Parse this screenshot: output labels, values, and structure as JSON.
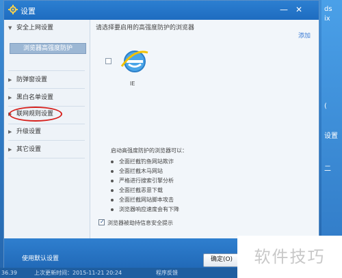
{
  "window": {
    "title": "设置"
  },
  "sidebar": {
    "items": [
      {
        "label": "安全上网设置",
        "expanded": true
      },
      {
        "label": "防弹窗设置",
        "expanded": false
      },
      {
        "label": "黑白名单设置",
        "expanded": false
      },
      {
        "label": "联网规则设置",
        "expanded": false
      },
      {
        "label": "升级设置",
        "expanded": false
      },
      {
        "label": "其它设置",
        "expanded": false
      }
    ],
    "subitem": "浏览器高强度防护"
  },
  "main": {
    "heading": "请选择要启用的高强度防护的浏览器",
    "add_link": "添加",
    "browser_label": "IE",
    "features_title": "启动高强度防护的浏览器可以：",
    "features": [
      "全面拦截钓鱼网站欺诈",
      "全面拦截木马网站",
      "严格进行搜索引擎分析",
      "全面拦截恶意下载",
      "全面拦截网站脚本攻击",
      "浏览器响应速度会有下降"
    ],
    "option_label": "浏览器被劫持信息安全提示"
  },
  "footer": {
    "apply_text": "使用默认设置",
    "ok_label": "确定(O)"
  },
  "statusbar": {
    "left": "36.39",
    "last_update": "上次更新时间：2015-11-21 20:24",
    "feedback": "程序反馈"
  },
  "desktop": {
    "right_fragments": [
      "ds",
      "ix",
      "设置",
      "(",
      "二"
    ]
  },
  "overlay": {
    "text": "软件技巧"
  },
  "colors": {
    "accent_blue": "#1e6cc0",
    "highlight_red": "#d6201c"
  }
}
